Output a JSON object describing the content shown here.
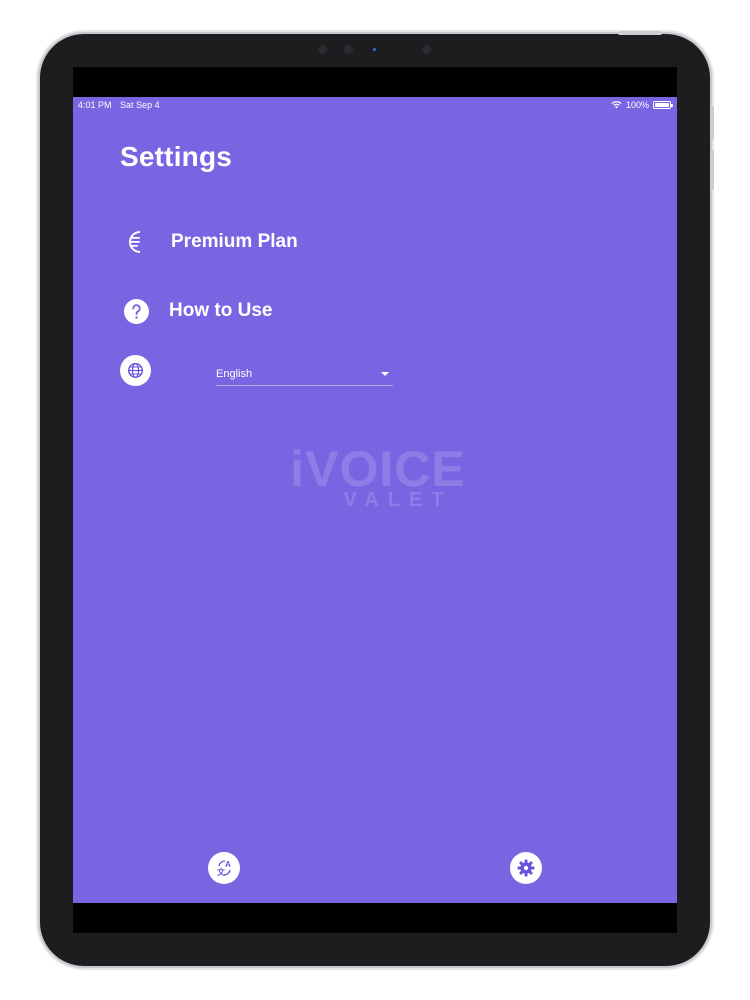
{
  "status_bar": {
    "time": "4:01 PM",
    "date": "Sat Sep 4",
    "battery": "100%",
    "wifi_icon": "wifi-icon",
    "battery_icon": "battery-icon"
  },
  "settings": {
    "title": "Settings",
    "items": [
      {
        "label": "Premium Plan",
        "icon": "premium-icon"
      },
      {
        "label": "How to Use",
        "icon": "question-icon"
      }
    ],
    "language": {
      "icon": "globe-icon",
      "selected": "English"
    }
  },
  "watermark": {
    "main": "iVOICE",
    "sub": "VALET"
  },
  "bottom_bar": {
    "left_icon": "translate-icon",
    "right_icon": "gear-icon"
  },
  "colors": {
    "background": "#7b64e2",
    "text": "#ffffff",
    "icon_accent": "#6a53d9"
  }
}
